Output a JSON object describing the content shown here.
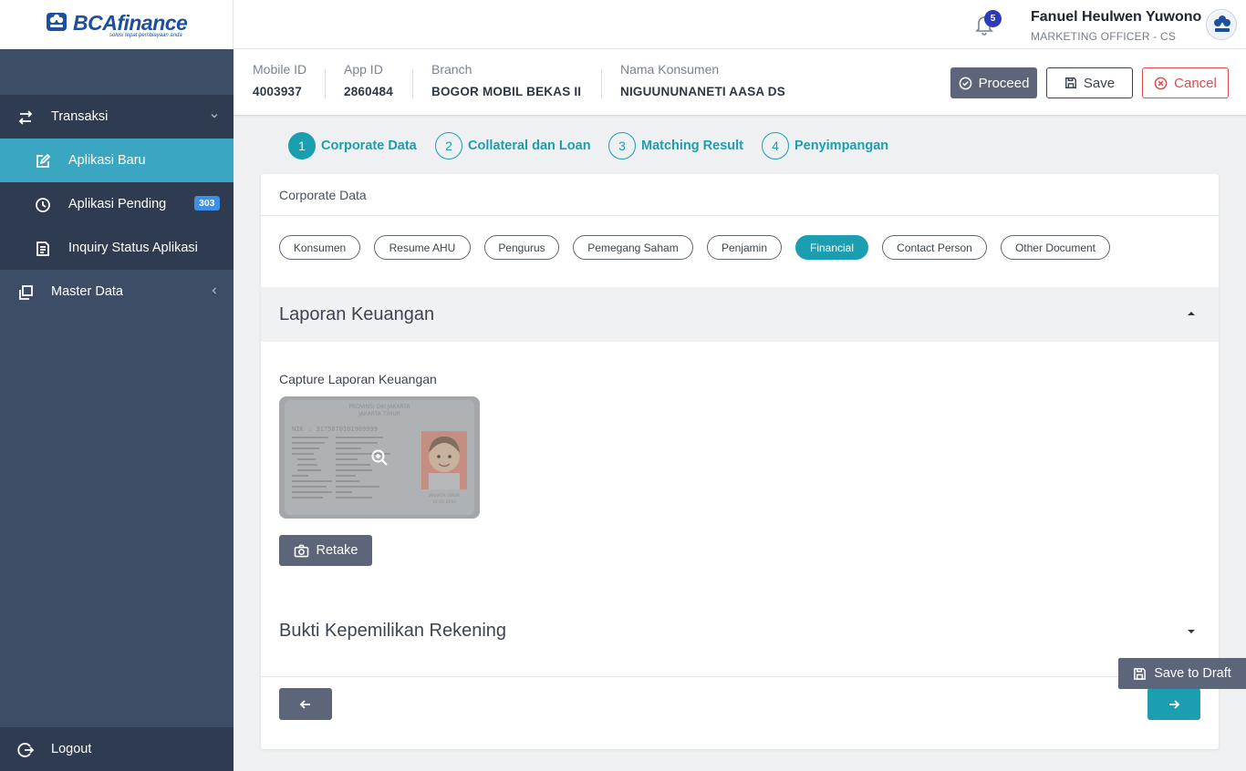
{
  "brand": {
    "name": "BCAfinance",
    "tagline": "solusi tepat pembiayaan anda"
  },
  "sidebar": {
    "items": [
      {
        "label": "Transaksi",
        "icon": "swap-arrows-icon"
      },
      {
        "label": "Aplikasi Baru",
        "icon": "edit-square-icon",
        "active": true
      },
      {
        "label": "Aplikasi Pending",
        "icon": "clock-icon",
        "badge": "303"
      },
      {
        "label": "Inquiry Status Aplikasi",
        "icon": "document-list-icon"
      },
      {
        "label": "Master Data",
        "icon": "copy-stack-icon"
      }
    ],
    "logout": "Logout"
  },
  "header": {
    "notifications": "5",
    "user_name": "Fanuel Heulwen Yuwono",
    "user_role": "MARKETING OFFICER - CS"
  },
  "info": {
    "mobile_id_label": "Mobile ID",
    "mobile_id": "4003937",
    "app_id_label": "App ID",
    "app_id": "2860484",
    "branch_label": "Branch",
    "branch": "BOGOR MOBIL BEKAS II",
    "nama_label": "Nama Konsumen",
    "nama": "NIGUUNUNANETI AASA DS"
  },
  "actions": {
    "proceed": "Proceed",
    "save": "Save",
    "cancel": "Cancel"
  },
  "steps": [
    {
      "num": "1",
      "label": "Corporate Data"
    },
    {
      "num": "2",
      "label": "Collateral dan Loan"
    },
    {
      "num": "3",
      "label": "Matching Result"
    },
    {
      "num": "4",
      "label": "Penyimpangan"
    }
  ],
  "card": {
    "title": "Corporate Data",
    "tabs": [
      "Konsumen",
      "Resume AHU",
      "Pengurus",
      "Pemegang Saham",
      "Penjamin",
      "Financial",
      "Contact Person",
      "Other Document"
    ],
    "active_tab": "Financial",
    "section1_title": "Laporan Keuangan",
    "capture_label": "Capture Laporan Keuangan",
    "retake": "Retake",
    "section2_title": "Bukti Kepemilikan Rekening"
  },
  "id_card": {
    "province": "PROVINSI DKI JAKARTA",
    "city": "JAKARTA TIMUR",
    "nik_label": "NIK",
    "nik": ": 3175070101909999",
    "sign_city": "JAKARTA TIMUR",
    "sign_date": "12-02-2014"
  },
  "save_draft": "Save to Draft",
  "colors": {
    "teal": "#1b9fb0",
    "sidebar": "#3e4d66",
    "danger": "#e04b4b",
    "slate": "#5c6579"
  }
}
